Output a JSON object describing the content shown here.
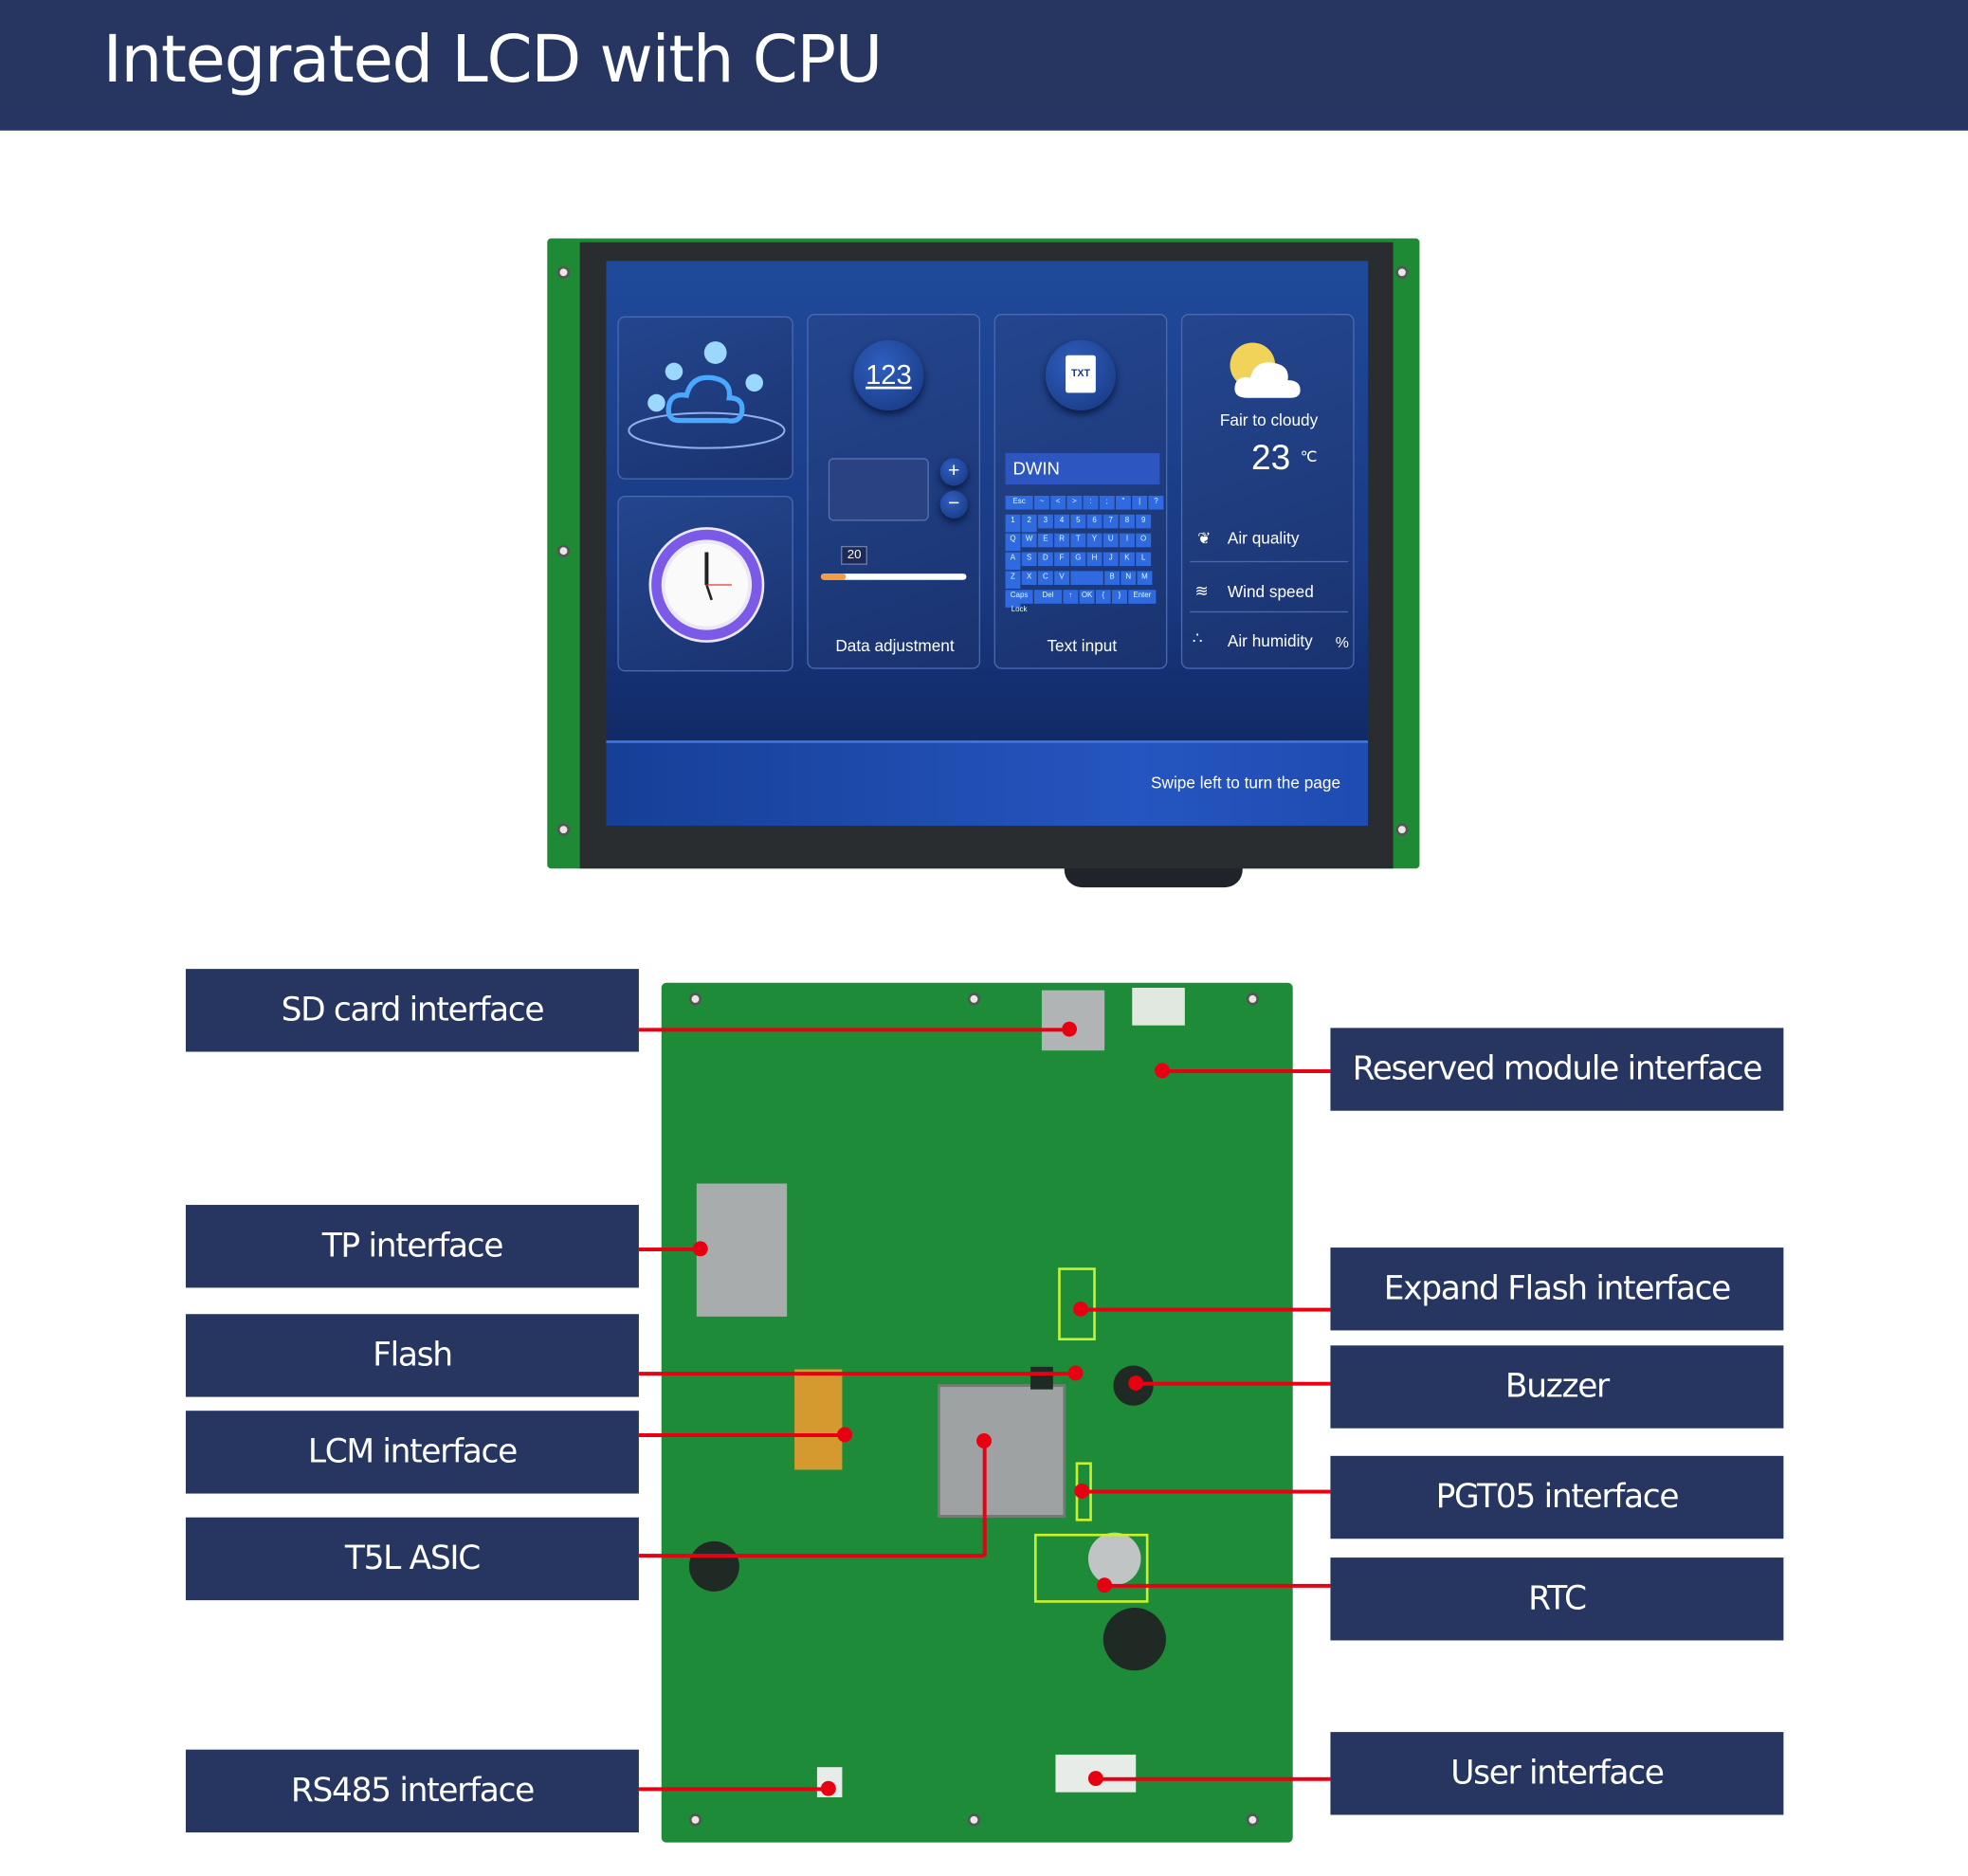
{
  "header": {
    "title": "Integrated LCD with CPU"
  },
  "screen": {
    "tile_data": {
      "icon": "123-icon",
      "slider_value": "20",
      "label": "Data adjustment"
    },
    "tile_text": {
      "icon": "txt-file-icon",
      "input_value": "DWIN",
      "label": "Text input",
      "keyboard": [
        [
          "Esc",
          "~",
          "<",
          ">",
          ":",
          ";",
          "\"",
          "|",
          "?",
          "—",
          "+"
        ],
        [
          "1",
          "2",
          "3",
          "4",
          "5",
          "6",
          "7",
          "8",
          "9",
          "0"
        ],
        [
          "Q",
          "W",
          "E",
          "R",
          "T",
          "Y",
          "U",
          "I",
          "O",
          "P"
        ],
        [
          "A",
          "S",
          "D",
          "F",
          "G",
          "H",
          "J",
          "K",
          "L",
          "←"
        ],
        [
          "Z",
          "X",
          "C",
          "V",
          " ",
          "B",
          "N",
          "M",
          "→"
        ],
        [
          "Caps Lock",
          "Del",
          "↑",
          "OK",
          "{",
          "}",
          "Enter"
        ]
      ]
    },
    "tile_weather": {
      "condition": "Fair to cloudy",
      "temperature": "23",
      "unit": "℃",
      "items": [
        "Air quality",
        "Wind speed",
        "Air humidity"
      ],
      "humidity_unit": "%"
    },
    "footer": "Swipe left to turn the page"
  },
  "labels": {
    "left": [
      "SD card interface",
      "TP interface",
      "Flash",
      "LCM interface",
      "T5L ASIC",
      "RS485 interface"
    ],
    "right": [
      "Reserved module interface",
      "Expand Flash interface",
      "Buzzer",
      "PGT05 interface",
      "RTC",
      "User interface"
    ]
  },
  "colors": {
    "label_bg": "#263660",
    "pointer": "#e60012",
    "pcb": "#1e8b38",
    "highlight": "#c8f030"
  }
}
